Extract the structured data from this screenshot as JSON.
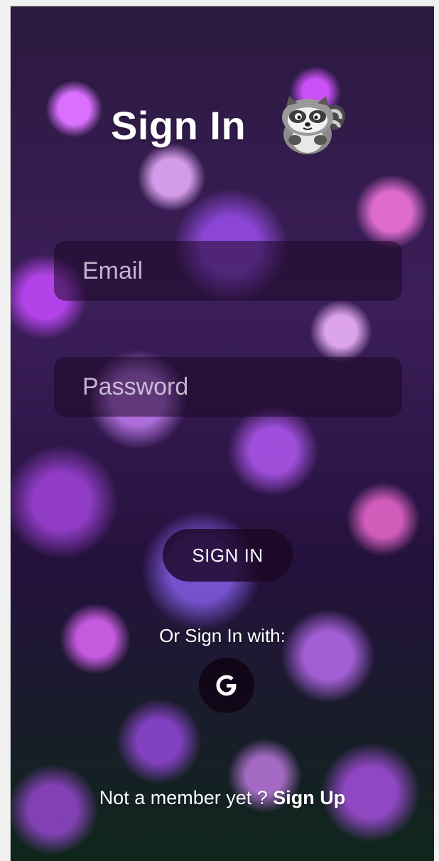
{
  "header": {
    "title": "Sign In",
    "mascot_icon": "raccoon-icon"
  },
  "form": {
    "email_placeholder": "Email",
    "email_value": "",
    "password_placeholder": "Password",
    "password_value": "",
    "submit_label": "SIGN IN"
  },
  "social": {
    "prompt": "Or Sign In with:",
    "google_icon": "google-icon"
  },
  "footer": {
    "prompt": "Not a member yet ? ",
    "link_label": "Sign Up"
  },
  "colors": {
    "text": "#ffffff",
    "field_bg": "#190823",
    "button_bg": "#1c0624"
  }
}
